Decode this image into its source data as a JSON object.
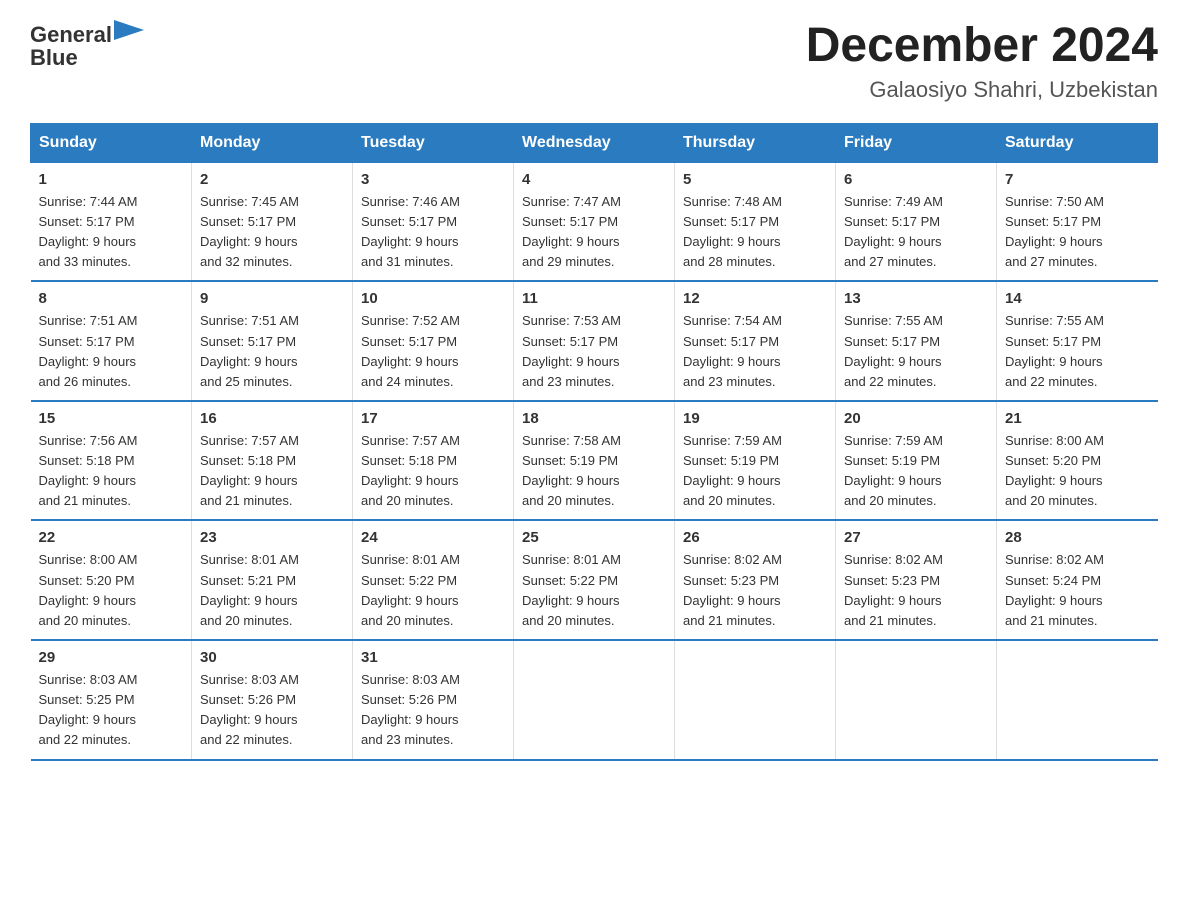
{
  "logo": {
    "text_general": "General",
    "text_blue": "Blue",
    "aria": "GeneralBlue logo"
  },
  "header": {
    "month_year": "December 2024",
    "location": "Galaosiyo Shahri, Uzbekistan"
  },
  "days_of_week": [
    "Sunday",
    "Monday",
    "Tuesday",
    "Wednesday",
    "Thursday",
    "Friday",
    "Saturday"
  ],
  "weeks": [
    [
      {
        "day": "1",
        "sunrise": "7:44 AM",
        "sunset": "5:17 PM",
        "daylight": "9 hours and 33 minutes."
      },
      {
        "day": "2",
        "sunrise": "7:45 AM",
        "sunset": "5:17 PM",
        "daylight": "9 hours and 32 minutes."
      },
      {
        "day": "3",
        "sunrise": "7:46 AM",
        "sunset": "5:17 PM",
        "daylight": "9 hours and 31 minutes."
      },
      {
        "day": "4",
        "sunrise": "7:47 AM",
        "sunset": "5:17 PM",
        "daylight": "9 hours and 29 minutes."
      },
      {
        "day": "5",
        "sunrise": "7:48 AM",
        "sunset": "5:17 PM",
        "daylight": "9 hours and 28 minutes."
      },
      {
        "day": "6",
        "sunrise": "7:49 AM",
        "sunset": "5:17 PM",
        "daylight": "9 hours and 27 minutes."
      },
      {
        "day": "7",
        "sunrise": "7:50 AM",
        "sunset": "5:17 PM",
        "daylight": "9 hours and 27 minutes."
      }
    ],
    [
      {
        "day": "8",
        "sunrise": "7:51 AM",
        "sunset": "5:17 PM",
        "daylight": "9 hours and 26 minutes."
      },
      {
        "day": "9",
        "sunrise": "7:51 AM",
        "sunset": "5:17 PM",
        "daylight": "9 hours and 25 minutes."
      },
      {
        "day": "10",
        "sunrise": "7:52 AM",
        "sunset": "5:17 PM",
        "daylight": "9 hours and 24 minutes."
      },
      {
        "day": "11",
        "sunrise": "7:53 AM",
        "sunset": "5:17 PM",
        "daylight": "9 hours and 23 minutes."
      },
      {
        "day": "12",
        "sunrise": "7:54 AM",
        "sunset": "5:17 PM",
        "daylight": "9 hours and 23 minutes."
      },
      {
        "day": "13",
        "sunrise": "7:55 AM",
        "sunset": "5:17 PM",
        "daylight": "9 hours and 22 minutes."
      },
      {
        "day": "14",
        "sunrise": "7:55 AM",
        "sunset": "5:17 PM",
        "daylight": "9 hours and 22 minutes."
      }
    ],
    [
      {
        "day": "15",
        "sunrise": "7:56 AM",
        "sunset": "5:18 PM",
        "daylight": "9 hours and 21 minutes."
      },
      {
        "day": "16",
        "sunrise": "7:57 AM",
        "sunset": "5:18 PM",
        "daylight": "9 hours and 21 minutes."
      },
      {
        "day": "17",
        "sunrise": "7:57 AM",
        "sunset": "5:18 PM",
        "daylight": "9 hours and 20 minutes."
      },
      {
        "day": "18",
        "sunrise": "7:58 AM",
        "sunset": "5:19 PM",
        "daylight": "9 hours and 20 minutes."
      },
      {
        "day": "19",
        "sunrise": "7:59 AM",
        "sunset": "5:19 PM",
        "daylight": "9 hours and 20 minutes."
      },
      {
        "day": "20",
        "sunrise": "7:59 AM",
        "sunset": "5:19 PM",
        "daylight": "9 hours and 20 minutes."
      },
      {
        "day": "21",
        "sunrise": "8:00 AM",
        "sunset": "5:20 PM",
        "daylight": "9 hours and 20 minutes."
      }
    ],
    [
      {
        "day": "22",
        "sunrise": "8:00 AM",
        "sunset": "5:20 PM",
        "daylight": "9 hours and 20 minutes."
      },
      {
        "day": "23",
        "sunrise": "8:01 AM",
        "sunset": "5:21 PM",
        "daylight": "9 hours and 20 minutes."
      },
      {
        "day": "24",
        "sunrise": "8:01 AM",
        "sunset": "5:22 PM",
        "daylight": "9 hours and 20 minutes."
      },
      {
        "day": "25",
        "sunrise": "8:01 AM",
        "sunset": "5:22 PM",
        "daylight": "9 hours and 20 minutes."
      },
      {
        "day": "26",
        "sunrise": "8:02 AM",
        "sunset": "5:23 PM",
        "daylight": "9 hours and 21 minutes."
      },
      {
        "day": "27",
        "sunrise": "8:02 AM",
        "sunset": "5:23 PM",
        "daylight": "9 hours and 21 minutes."
      },
      {
        "day": "28",
        "sunrise": "8:02 AM",
        "sunset": "5:24 PM",
        "daylight": "9 hours and 21 minutes."
      }
    ],
    [
      {
        "day": "29",
        "sunrise": "8:03 AM",
        "sunset": "5:25 PM",
        "daylight": "9 hours and 22 minutes."
      },
      {
        "day": "30",
        "sunrise": "8:03 AM",
        "sunset": "5:26 PM",
        "daylight": "9 hours and 22 minutes."
      },
      {
        "day": "31",
        "sunrise": "8:03 AM",
        "sunset": "5:26 PM",
        "daylight": "9 hours and 23 minutes."
      },
      {
        "day": "",
        "sunrise": "",
        "sunset": "",
        "daylight": ""
      },
      {
        "day": "",
        "sunrise": "",
        "sunset": "",
        "daylight": ""
      },
      {
        "day": "",
        "sunrise": "",
        "sunset": "",
        "daylight": ""
      },
      {
        "day": "",
        "sunrise": "",
        "sunset": "",
        "daylight": ""
      }
    ]
  ],
  "labels": {
    "sunrise": "Sunrise:",
    "sunset": "Sunset:",
    "daylight": "Daylight:"
  }
}
